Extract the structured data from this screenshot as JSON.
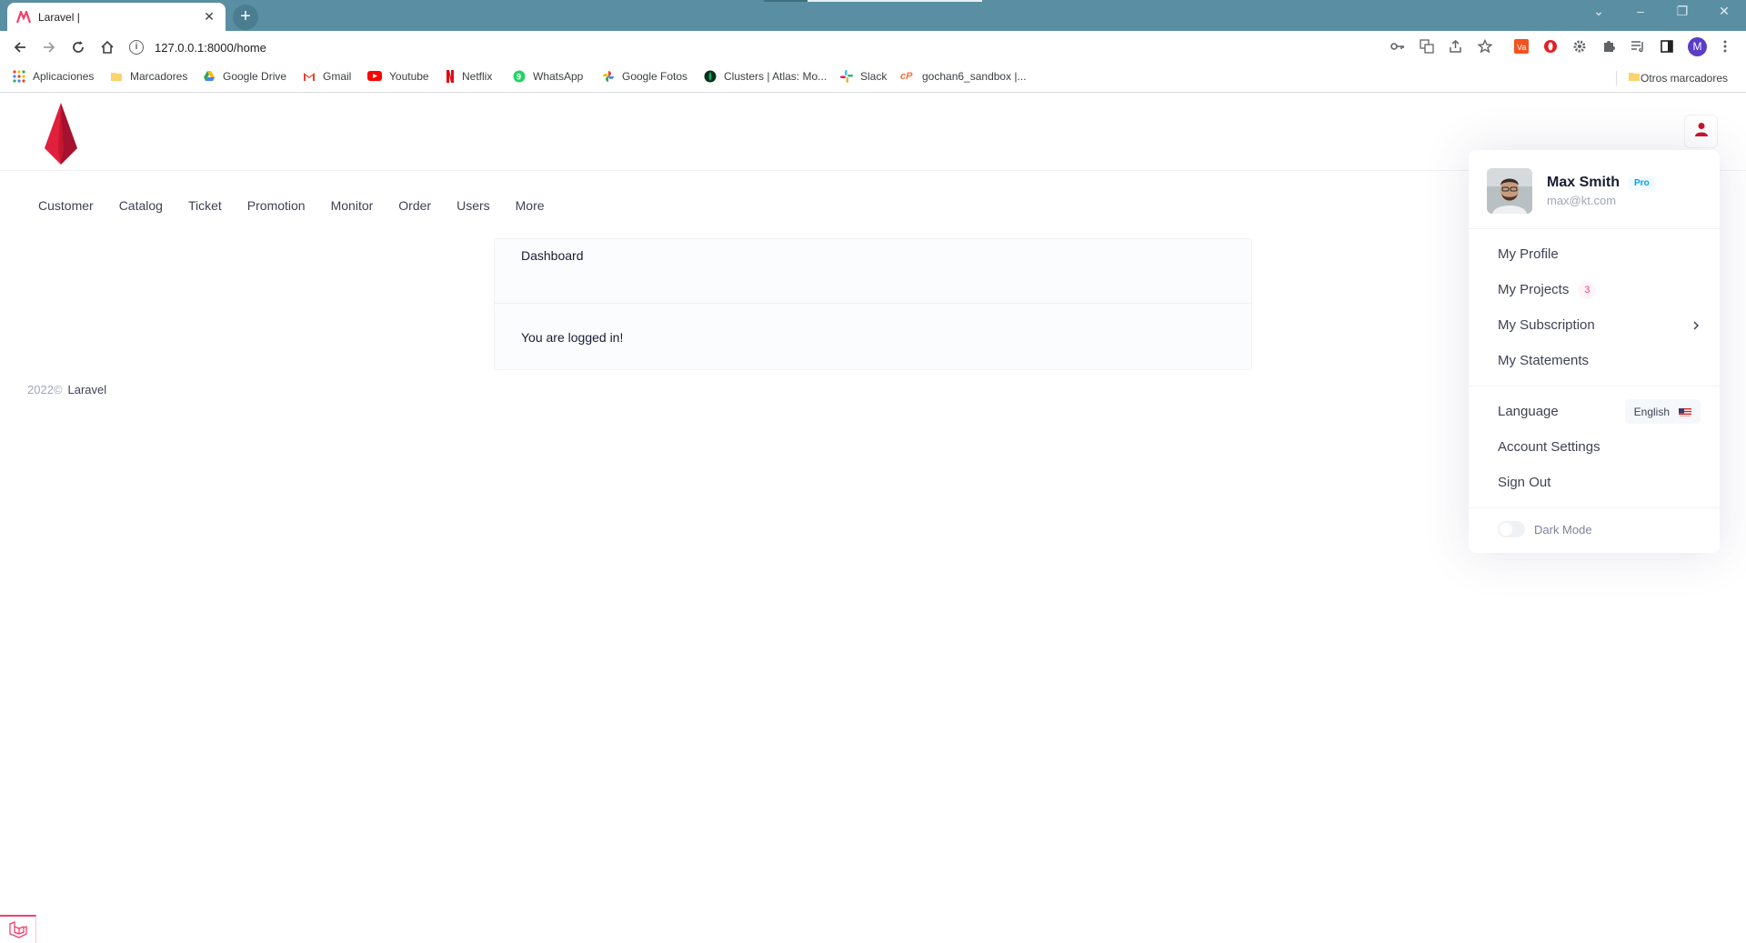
{
  "browser": {
    "tab_title": "Laravel |",
    "tab_close": "✕",
    "new_tab": "+",
    "url": "127.0.0.1:8000/home",
    "window_controls": [
      "⌄",
      "–",
      "❐",
      "✕"
    ]
  },
  "bookmarks": {
    "items": [
      {
        "label": "Aplicaciones",
        "icon": "apps-grid-icon",
        "color": "#ea4335"
      },
      {
        "label": "Marcadores",
        "icon": "folder-icon",
        "color": "#f9d36b"
      },
      {
        "label": "Google Drive",
        "icon": "google-drive-icon",
        "color": "#34a853"
      },
      {
        "label": "Gmail",
        "icon": "gmail-icon",
        "color": "#ea4335"
      },
      {
        "label": "Youtube",
        "icon": "youtube-icon",
        "color": "#ff0000"
      },
      {
        "label": "Netflix",
        "icon": "netflix-icon",
        "color": "#e50914"
      },
      {
        "label": "WhatsApp",
        "icon": "whatsapp-icon",
        "color": "#25d366"
      },
      {
        "label": "Google Fotos",
        "icon": "google-photos-icon",
        "color": "#fbbc04"
      },
      {
        "label": "Clusters | Atlas: Mo...",
        "icon": "mongodb-icon",
        "color": "#13aa52"
      },
      {
        "label": "Slack",
        "icon": "slack-icon",
        "color": "#36c5f0"
      },
      {
        "label": "gochan6_sandbox |...",
        "icon": "postman-icon",
        "color": "#ff6c37"
      }
    ],
    "other": "Otros marcadores"
  },
  "nav": {
    "items": [
      "Customer",
      "Catalog",
      "Ticket",
      "Promotion",
      "Monitor",
      "Order",
      "Users",
      "More"
    ]
  },
  "card": {
    "header": "Dashboard",
    "body": "You are logged in!"
  },
  "footer": {
    "year": "2022©",
    "brand": "Laravel"
  },
  "user_menu": {
    "name": "Max Smith",
    "badge": "Pro",
    "email": "max@kt.com",
    "items": {
      "profile": "My Profile",
      "projects": "My Projects",
      "projects_count": "3",
      "subscription": "My Subscription",
      "statements": "My Statements",
      "language": "Language",
      "language_value": "English",
      "account_settings": "Account Settings",
      "sign_out": "Sign Out",
      "dark_mode": "Dark Mode"
    }
  },
  "colors": {
    "tabstrip": "#5a8fa3",
    "brand_red": "#d9214e",
    "primary": "#009ef7",
    "danger": "#f1416c"
  }
}
